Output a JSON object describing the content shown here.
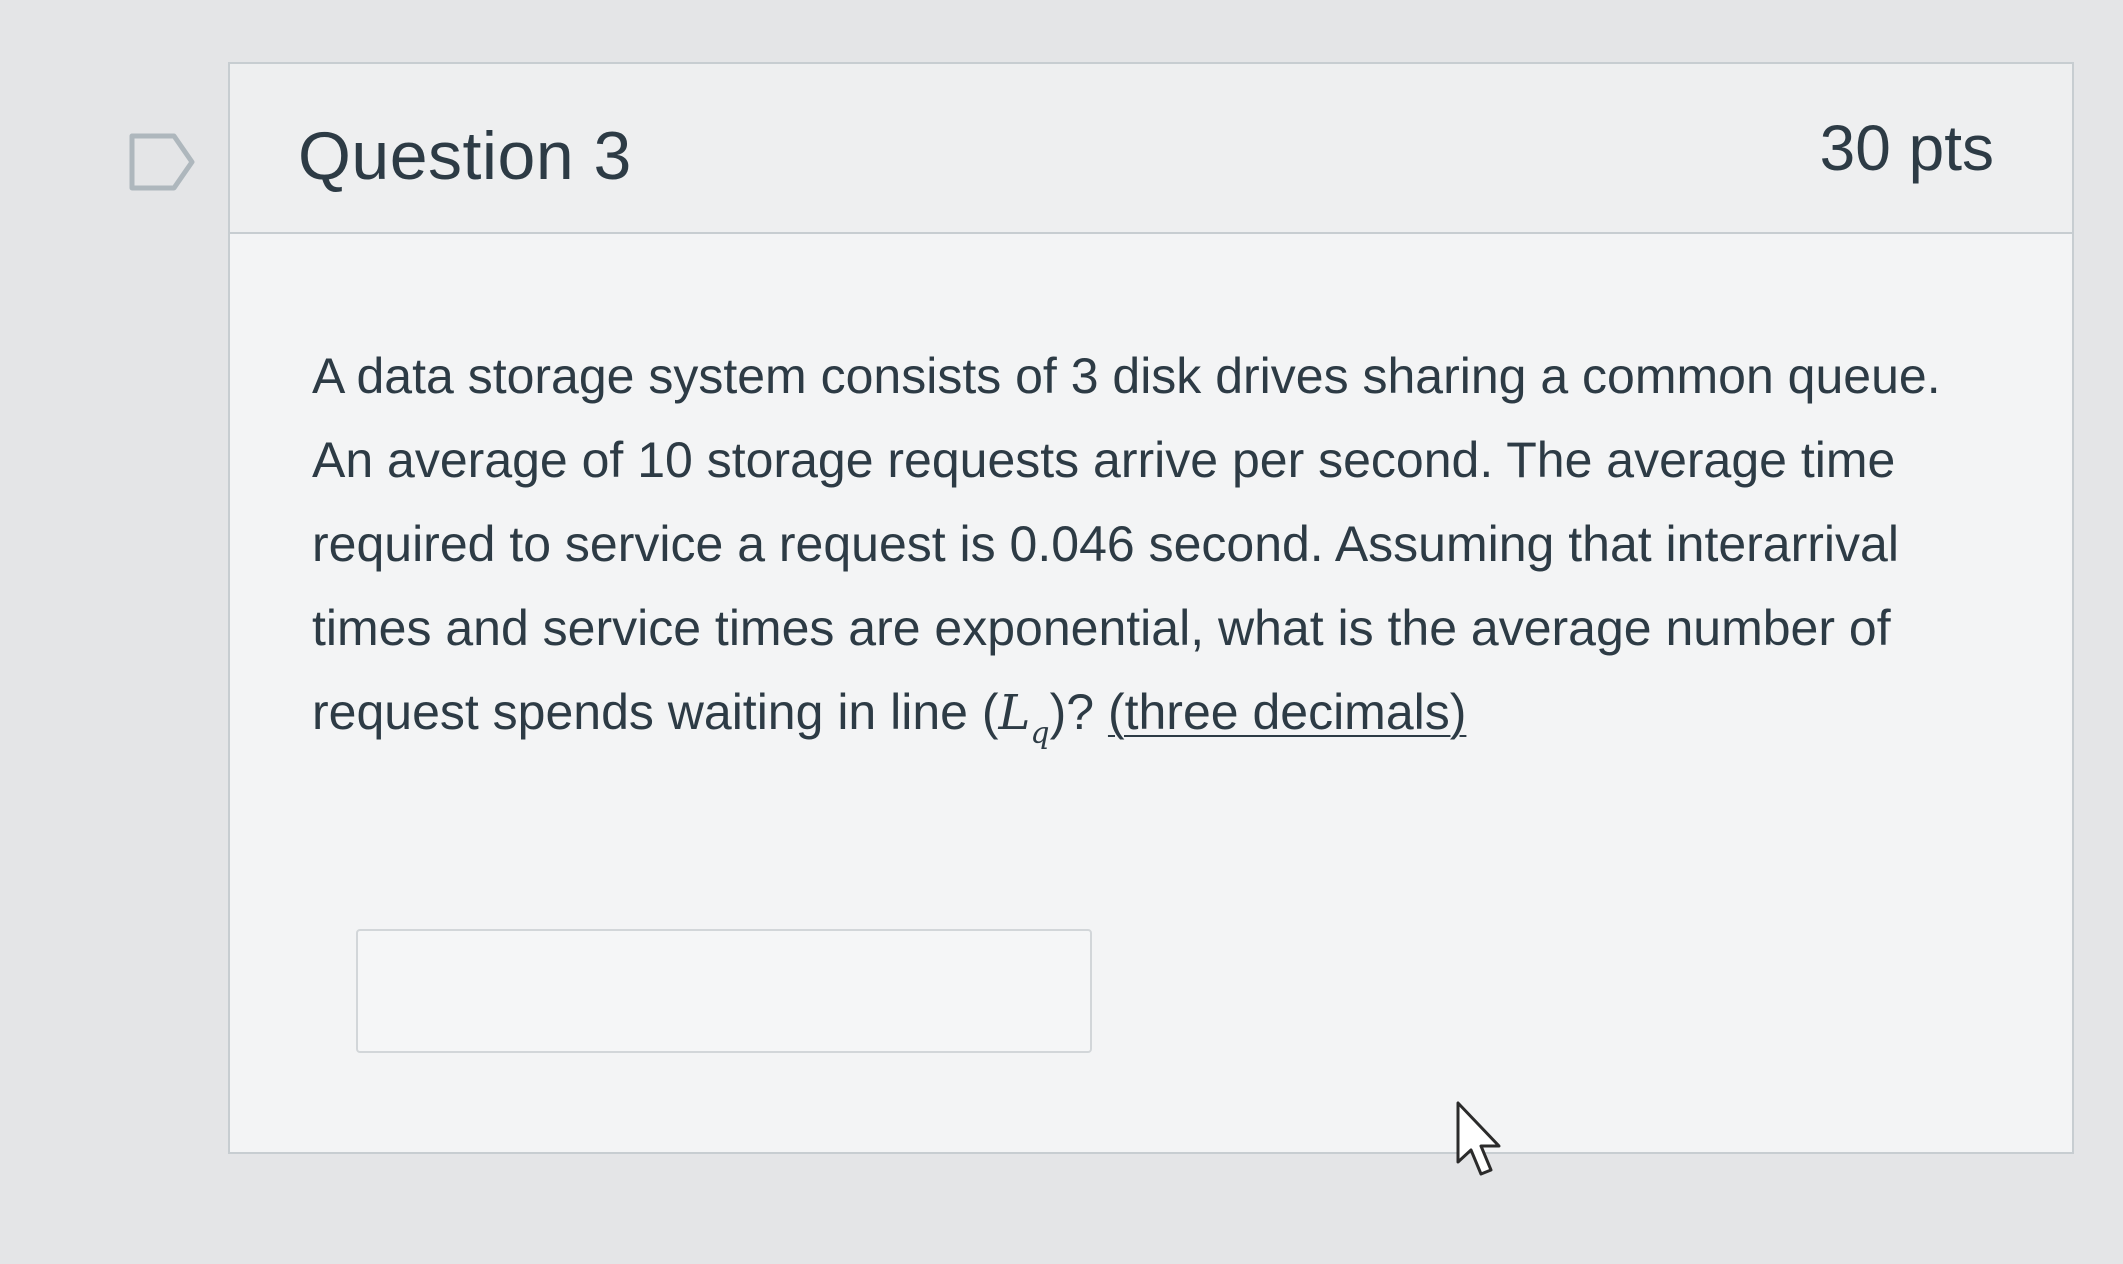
{
  "question": {
    "title": "Question 3",
    "points": "30 pts",
    "text_line1": "A data storage system consists of 3 disk drives sharing a common queue. An average of 10 storage requests arrive per second. The average time required to service a request is 0.046 second. Assuming that interarrival times and service times are exponential, what is the average number of request spends waiting in line (",
    "math_var": "L",
    "math_sub": "q",
    "text_after_math": ")? ",
    "note": "(three decimals)"
  },
  "answer": {
    "value": "",
    "placeholder": ""
  },
  "icons": {
    "flag": "flag-outline-icon",
    "cursor": "mouse-pointer-icon"
  },
  "colors": {
    "text": "#2d3b45",
    "border": "#c7cdd1",
    "background": "#e4e5e7"
  }
}
